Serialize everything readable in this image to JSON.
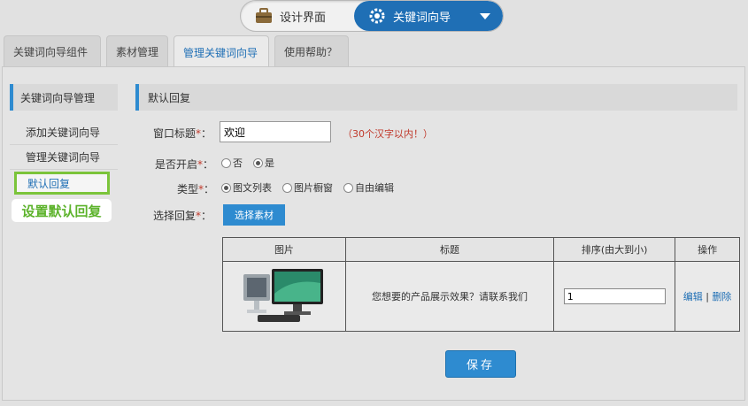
{
  "switcher": {
    "design_label": "设计界面",
    "wizard_label": "关键词向导"
  },
  "tabs": [
    {
      "label": "关键词向导组件"
    },
    {
      "label": "素材管理"
    },
    {
      "label": "管理关键词向导"
    },
    {
      "label": "使用帮助？"
    }
  ],
  "sidebar": {
    "title": "关键词向导管理",
    "items": [
      {
        "label": "添加关键词向导"
      },
      {
        "label": "管理关键词向导"
      },
      {
        "label": "默认回复"
      }
    ],
    "callout": "设置默认回复"
  },
  "section": {
    "title": "默认回复"
  },
  "form": {
    "title_label": "窗口标题",
    "title_value": "欢迎",
    "title_hint": "（30个汉字以内！）",
    "enable_label": "是否开启",
    "enable_options": [
      "否",
      "是"
    ],
    "enable_selected": "是",
    "type_label": "类型",
    "type_options": [
      "图文列表",
      "图片橱窗",
      "自由编辑"
    ],
    "type_selected": "图文列表",
    "reply_label": "选择回复",
    "select_button": "选择素材",
    "required_mark": "*",
    "colon": "："
  },
  "table": {
    "headers": [
      "图片",
      "标题",
      "排序(由大到小)",
      "操作"
    ],
    "rows": [
      {
        "title": "您想要的产品展示效果？请联系我们",
        "order": "1",
        "edit": "编辑",
        "sep": "|",
        "delete": "删除"
      }
    ]
  },
  "save_button": "保存",
  "colors": {
    "accent": "#2e8bd0",
    "wizard_bg": "#1f6fb5",
    "highlight": "#7bc43a",
    "hint": "#c0392b"
  }
}
